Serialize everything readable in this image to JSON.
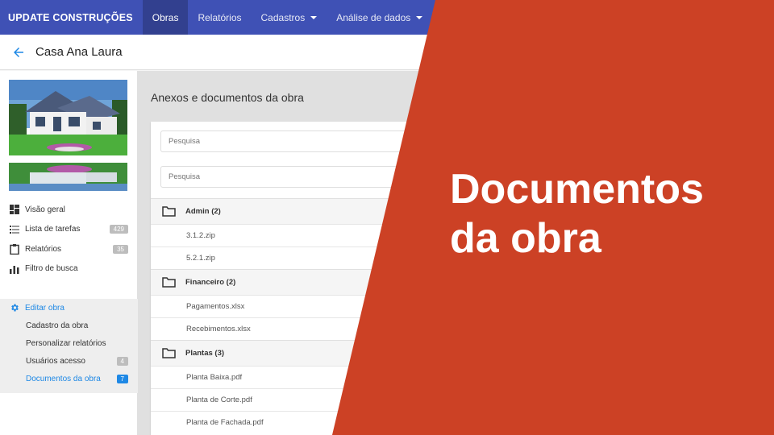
{
  "navbar": {
    "brand": "UPDATE CONSTRUÇÕES",
    "items": [
      {
        "label": "Obras",
        "active": true,
        "dropdown": false
      },
      {
        "label": "Relatórios",
        "active": false,
        "dropdown": false
      },
      {
        "label": "Cadastros",
        "active": false,
        "dropdown": true
      },
      {
        "label": "Análise de dados",
        "active": false,
        "dropdown": true
      }
    ]
  },
  "header": {
    "back_icon": "arrow-left-icon",
    "title": "Casa Ana Laura"
  },
  "sidebar": {
    "nav": [
      {
        "label": "Visão geral",
        "icon": "dashboard-icon",
        "badge": ""
      },
      {
        "label": "Lista de tarefas",
        "icon": "list-icon",
        "badge": "429"
      },
      {
        "label": "Relatórios",
        "icon": "clipboard-icon",
        "badge": "35"
      },
      {
        "label": "Filtro de busca",
        "icon": "bar-chart-icon",
        "badge": ""
      }
    ],
    "edit": {
      "label": "Editar obra",
      "icon": "gear-icon",
      "items": [
        {
          "label": "Cadastro da obra",
          "badge": "",
          "active": false
        },
        {
          "label": "Personalizar relatórios",
          "badge": "",
          "active": false
        },
        {
          "label": "Usuários acesso",
          "badge": "4",
          "active": false
        },
        {
          "label": "Documentos da obra",
          "badge": "7",
          "active": true
        }
      ]
    }
  },
  "content": {
    "title": "Anexos e documentos da obra",
    "search1_placeholder": "Pesquisa",
    "search2_placeholder": "Pesquisa",
    "folders": [
      {
        "name": "Admin (2)",
        "files": [
          "3.1.2.zip",
          "5.2.1.zip"
        ]
      },
      {
        "name": "Financeiro (2)",
        "files": [
          "Pagamentos.xlsx",
          "Recebimentos.xlsx"
        ]
      },
      {
        "name": "Plantas (3)",
        "files": [
          "Planta Baixa.pdf",
          "Planta de Corte.pdf",
          "Planta de Fachada.pdf"
        ]
      }
    ]
  },
  "overlay": {
    "line1": "Documentos",
    "line2": "da obra",
    "color": "#cc4125"
  },
  "colors": {
    "navbar": "#3f51b5",
    "navbar_active": "#32408f",
    "accent": "#1e88e5"
  }
}
